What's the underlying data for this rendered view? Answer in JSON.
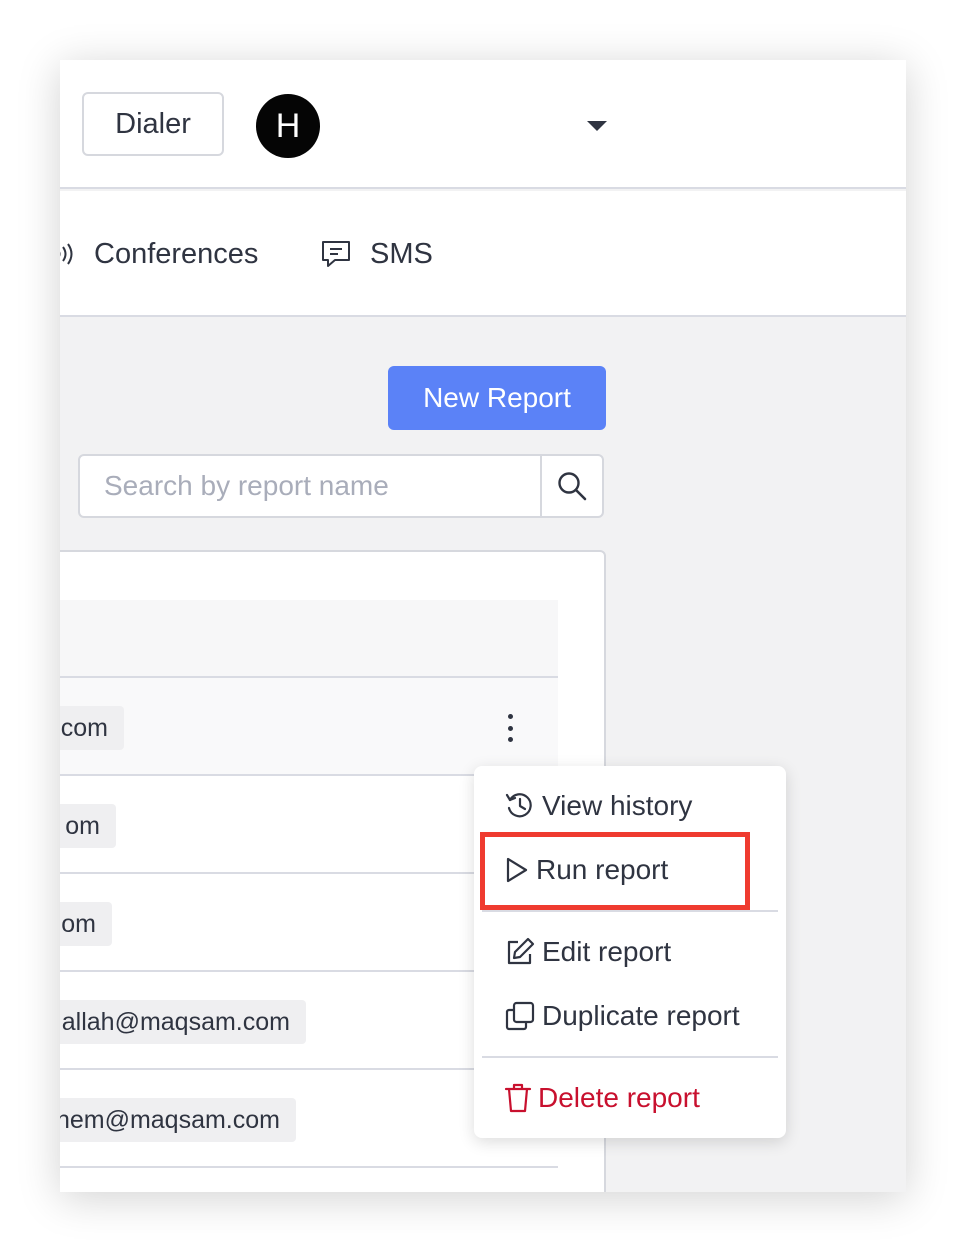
{
  "header": {
    "dialer_label": "Dialer",
    "avatar_initial": "H"
  },
  "nav": {
    "items": [
      {
        "label": "Conferences",
        "icon": "broadcast-icon"
      },
      {
        "label": "SMS",
        "icon": "message-icon"
      }
    ]
  },
  "toolbar": {
    "new_report_label": "New Report",
    "search_placeholder": "Search by report name"
  },
  "table": {
    "rows": [
      {
        "owner": ".com"
      },
      {
        "owner": "om"
      },
      {
        "owner": "om"
      },
      {
        "owner": "allah@maqsam.com"
      },
      {
        "owner": "hem@maqsam.com"
      }
    ]
  },
  "menu": {
    "view_history": "View history",
    "run_report": "Run report",
    "edit_report": "Edit report",
    "duplicate_report": "Duplicate report",
    "delete_report": "Delete report"
  },
  "colors": {
    "primary": "#5b82f7",
    "danger": "#c8102e",
    "highlight": "#ef3b2f"
  }
}
